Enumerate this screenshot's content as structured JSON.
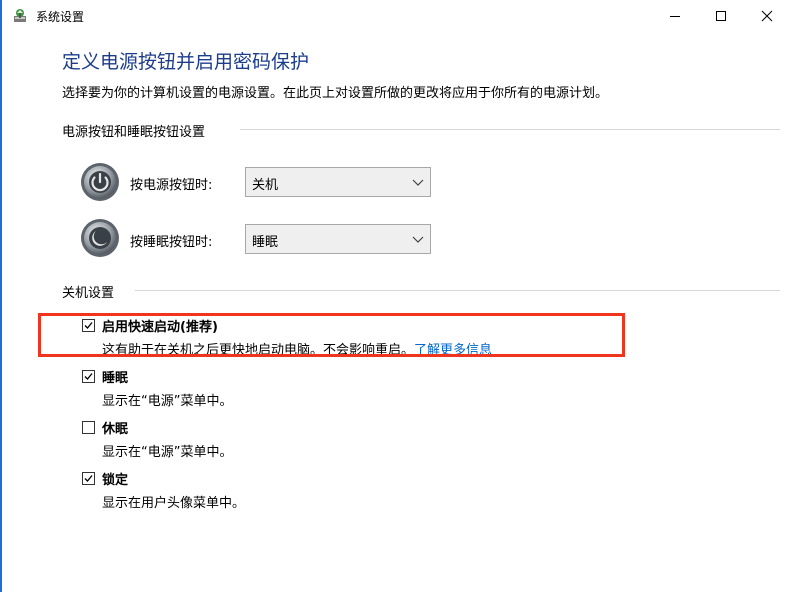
{
  "window": {
    "title": "系统设置",
    "controls": {
      "minimize": "minimize-icon",
      "maximize": "maximize-icon",
      "close": "close-icon"
    }
  },
  "page": {
    "title": "定义电源按钮并启用密码保护",
    "description": "选择要为你的计算机设置的电源设置。在此页上对设置所做的更改将应用于你所有的电源计划。"
  },
  "power_buttons_section": {
    "title": "电源按钮和睡眠按钮设置",
    "power_button": {
      "label": "按电源按钮时:",
      "value": "关机",
      "icon": "power-icon"
    },
    "sleep_button": {
      "label": "按睡眠按钮时:",
      "value": "睡眠",
      "icon": "sleep-icon"
    }
  },
  "shutdown_section": {
    "title": "关机设置",
    "options": [
      {
        "label": "启用快速启动(推荐)",
        "checked": true,
        "description": "这有助于在关机之后更快地启动电脑。不会影响重启。",
        "link": "了解更多信息"
      },
      {
        "label": "睡眠",
        "checked": true,
        "description": "显示在“电源”菜单中。"
      },
      {
        "label": "休眠",
        "checked": false,
        "description": "显示在“电源”菜单中。"
      },
      {
        "label": "锁定",
        "checked": true,
        "description": "显示在用户头像菜单中。"
      }
    ]
  },
  "colors": {
    "title_blue": "#1c3c8c",
    "link_blue": "#0066cc",
    "highlight_red": "#f0341d",
    "window_edge": "#1e6fd9"
  }
}
